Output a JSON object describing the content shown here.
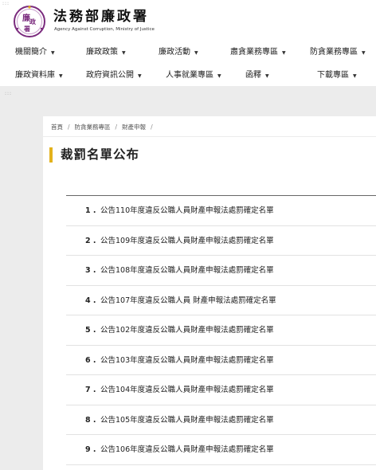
{
  "accesskey_marks": [
    ":::",
    ":::"
  ],
  "site": {
    "name_zh": "法務部廉政署",
    "name_en": "Agency Against Corruption, Ministry of Justice",
    "logo_text": "廉政署",
    "brand_color": "#7b2b7e"
  },
  "nav": {
    "row1": [
      "機關簡介",
      "廉政政策",
      "廉政活動",
      "肅貪業務專區",
      "防貪業務專區"
    ],
    "row2": [
      "廉政資料庫",
      "政府資訊公開",
      "人事就業專區",
      "函釋",
      "下載專區"
    ],
    "caret": "▼"
  },
  "breadcrumb": [
    "首頁",
    "防貪業務專區",
    "財產申報"
  ],
  "breadcrumb_sep": "/",
  "page": {
    "title": "裁罰名單公布",
    "accent_color": "#e3b21c"
  },
  "list": [
    {
      "num": "1 .",
      "text": "公告110年度違反公職人員財產申報法處罰確定名單"
    },
    {
      "num": "2 .",
      "text": "公告109年度違反公職人員財產申報法處罰確定名單"
    },
    {
      "num": "3 .",
      "text": "公告108年度違反公職人員財產申報法處罰確定名單"
    },
    {
      "num": "4 .",
      "text": "公告107年度違反公職人員 財產申報法處罰確定名單"
    },
    {
      "num": "5 .",
      "text": "公告102年度違反公職人員財產申報法處罰確定名單"
    },
    {
      "num": "6 .",
      "text": "公告103年度違反公職人員財產申報法處罰確定名單"
    },
    {
      "num": "7 .",
      "text": "公告104年度違反公職人員財產申報法處罰確定名單"
    },
    {
      "num": "8 .",
      "text": "公告105年度違反公職人員財產申報法處罰確定名單"
    },
    {
      "num": "9 .",
      "text": "公告106年度違反公職人員財產申報法處罰確定名單"
    }
  ]
}
